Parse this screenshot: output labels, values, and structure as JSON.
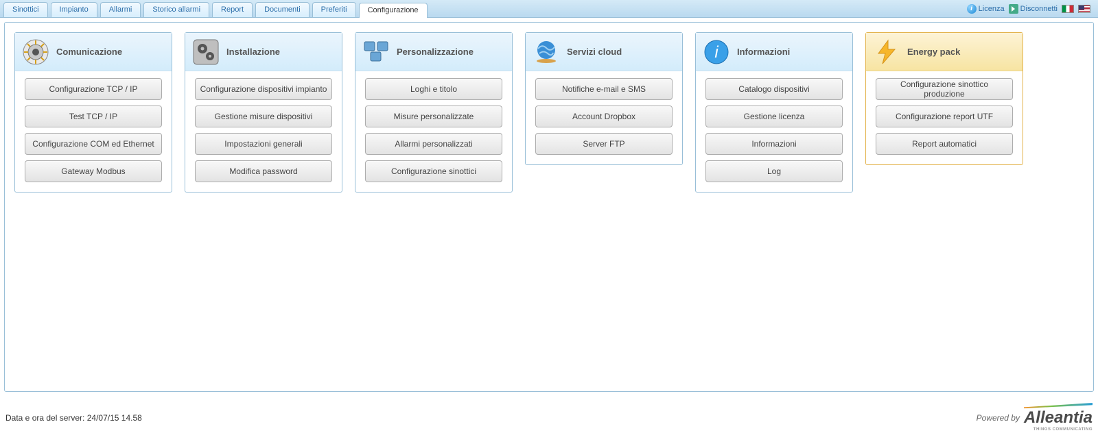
{
  "tabs": [
    {
      "label": "Sinottici"
    },
    {
      "label": "Impianto"
    },
    {
      "label": "Allarmi"
    },
    {
      "label": "Storico allarmi"
    },
    {
      "label": "Report"
    },
    {
      "label": "Documenti"
    },
    {
      "label": "Preferiti"
    },
    {
      "label": "Configurazione",
      "active": true
    }
  ],
  "header_right": {
    "license": "Licenza",
    "disconnect": "Disconnetti"
  },
  "cards": {
    "comunicazione": {
      "title": "Comunicazione",
      "buttons": [
        "Configurazione TCP / IP",
        "Test TCP / IP",
        "Configurazione COM ed Ethernet",
        "Gateway Modbus"
      ]
    },
    "installazione": {
      "title": "Installazione",
      "buttons": [
        "Configurazione dispositivi impianto",
        "Gestione misure dispositivi",
        "Impostazioni generali",
        "Modifica password"
      ]
    },
    "personalizzazione": {
      "title": "Personalizzazione",
      "buttons": [
        "Loghi e titolo",
        "Misure personalizzate",
        "Allarmi personalizzati",
        "Configurazione sinottici"
      ]
    },
    "servizi": {
      "title": "Servizi cloud",
      "buttons": [
        "Notifiche e-mail e SMS",
        "Account Dropbox",
        "Server FTP"
      ]
    },
    "informazioni": {
      "title": "Informazioni",
      "buttons": [
        "Catalogo dispositivi",
        "Gestione licenza",
        "Informazioni",
        "Log"
      ]
    },
    "energy": {
      "title": "Energy pack",
      "buttons": [
        "Configurazione sinottico produzione",
        "Configurazione report UTF",
        "Report automatici"
      ]
    }
  },
  "footer": {
    "datetime_label": "Data e ora del server: ",
    "datetime_value": "24/07/15 14.58",
    "powered_by": "Powered by",
    "brand": "Alleantia",
    "brand_sub": "THINGS COMMUNICATING"
  }
}
